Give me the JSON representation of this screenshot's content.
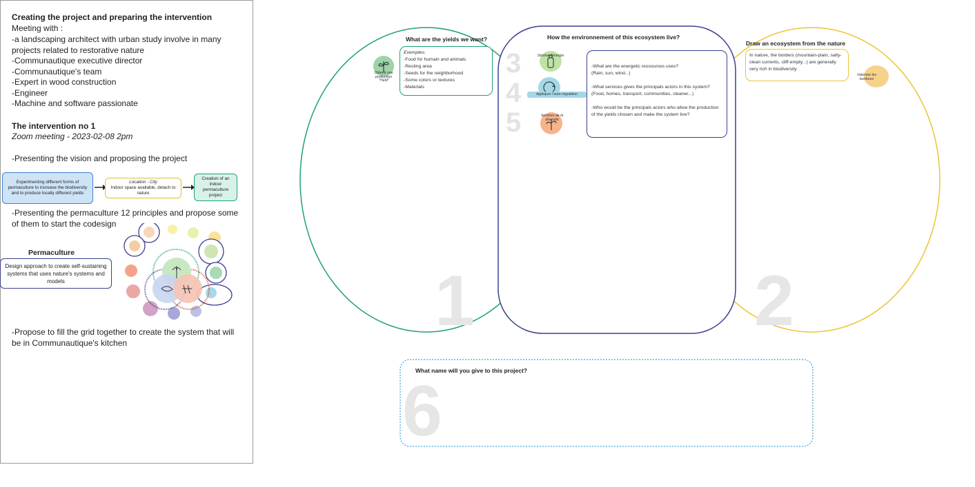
{
  "notes": {
    "title": "Creating the project and preparing the intervention",
    "meeting_with": "Meeting with :",
    "participants": [
      "-a landscaping architect with urban study involve in many projects related to restorative nature",
      "-Communautique executive director",
      "-Communautique's team",
      "-Expert in wood construction",
      "-Engineer",
      "-Machine and software passionate"
    ],
    "intervention_title": "The intervention no 1",
    "intervention_meta": "Zoom meeting - 2023-02-08 2pm",
    "step1": "-Presenting the vision and proposing the project",
    "flow": [
      {
        "text": "Experimenting different forms of permaculture to increase the biodiversity and to produce locally different yields"
      },
      {
        "title": "Location - City",
        "text": "Indoor space available, detach to nature"
      },
      {
        "text": "Creation of an indoor permaculture project"
      }
    ],
    "step2": "-Presenting the permaculture 12 principles and propose some of them to start the codesign",
    "permaculture_title": "Permaculture",
    "permaculture_def": "Design approach to create self-sustaining systems that uses nature's systems and models",
    "step3": "-Propose to fill the grid together to create the system that will be in Communautique's kitchen"
  },
  "board": {
    "yields": {
      "number": "1",
      "heading": "What are the yields we want?",
      "icon_caption": "Obtenir une production",
      "icon_caption_2": "\"Yield\"",
      "card_title": "Exemples:",
      "card_items": [
        "-Food for humain and animals",
        "-Resting area",
        "-Seeds for the neighborhood",
        "-Some colors or textures",
        "-Materials"
      ]
    },
    "environment": {
      "heading": "How the environnement of this ecosystem live?",
      "numbers": [
        "3",
        "4",
        "5"
      ],
      "icon_labels": [
        "Stocker l'énergie",
        "Appliquer l'auto-régulation",
        "Services de la diversité"
      ],
      "questions": [
        "-What are the energetic ressources uses?",
        "(Rain, sun, wind...)",
        "-What services gives the principals actors in this system?",
        "(Food, homes, transport, communities, cleaner...)",
        "-Who would be the principals actors who allow the production of the yields chosen and make the system live?"
      ]
    },
    "nature": {
      "number": "2",
      "heading": "Draw an ecosystem from the nature",
      "card_text": "In nature, the borders (mountain-plain, salty-clean currents, cliff-empty...) are generally very rich in biodiversity",
      "icon_label": "Valoriser les bordures"
    },
    "name": {
      "number": "6",
      "heading": "What name will you give to this project?"
    }
  },
  "colors": {
    "teal": "#1f9e7d",
    "navy": "#3a3f8f",
    "yellow": "#ecc430",
    "blue_fill": "#cfe3f7",
    "blue_border": "#3d7fd0",
    "number_gray": "#e6e6e6"
  }
}
